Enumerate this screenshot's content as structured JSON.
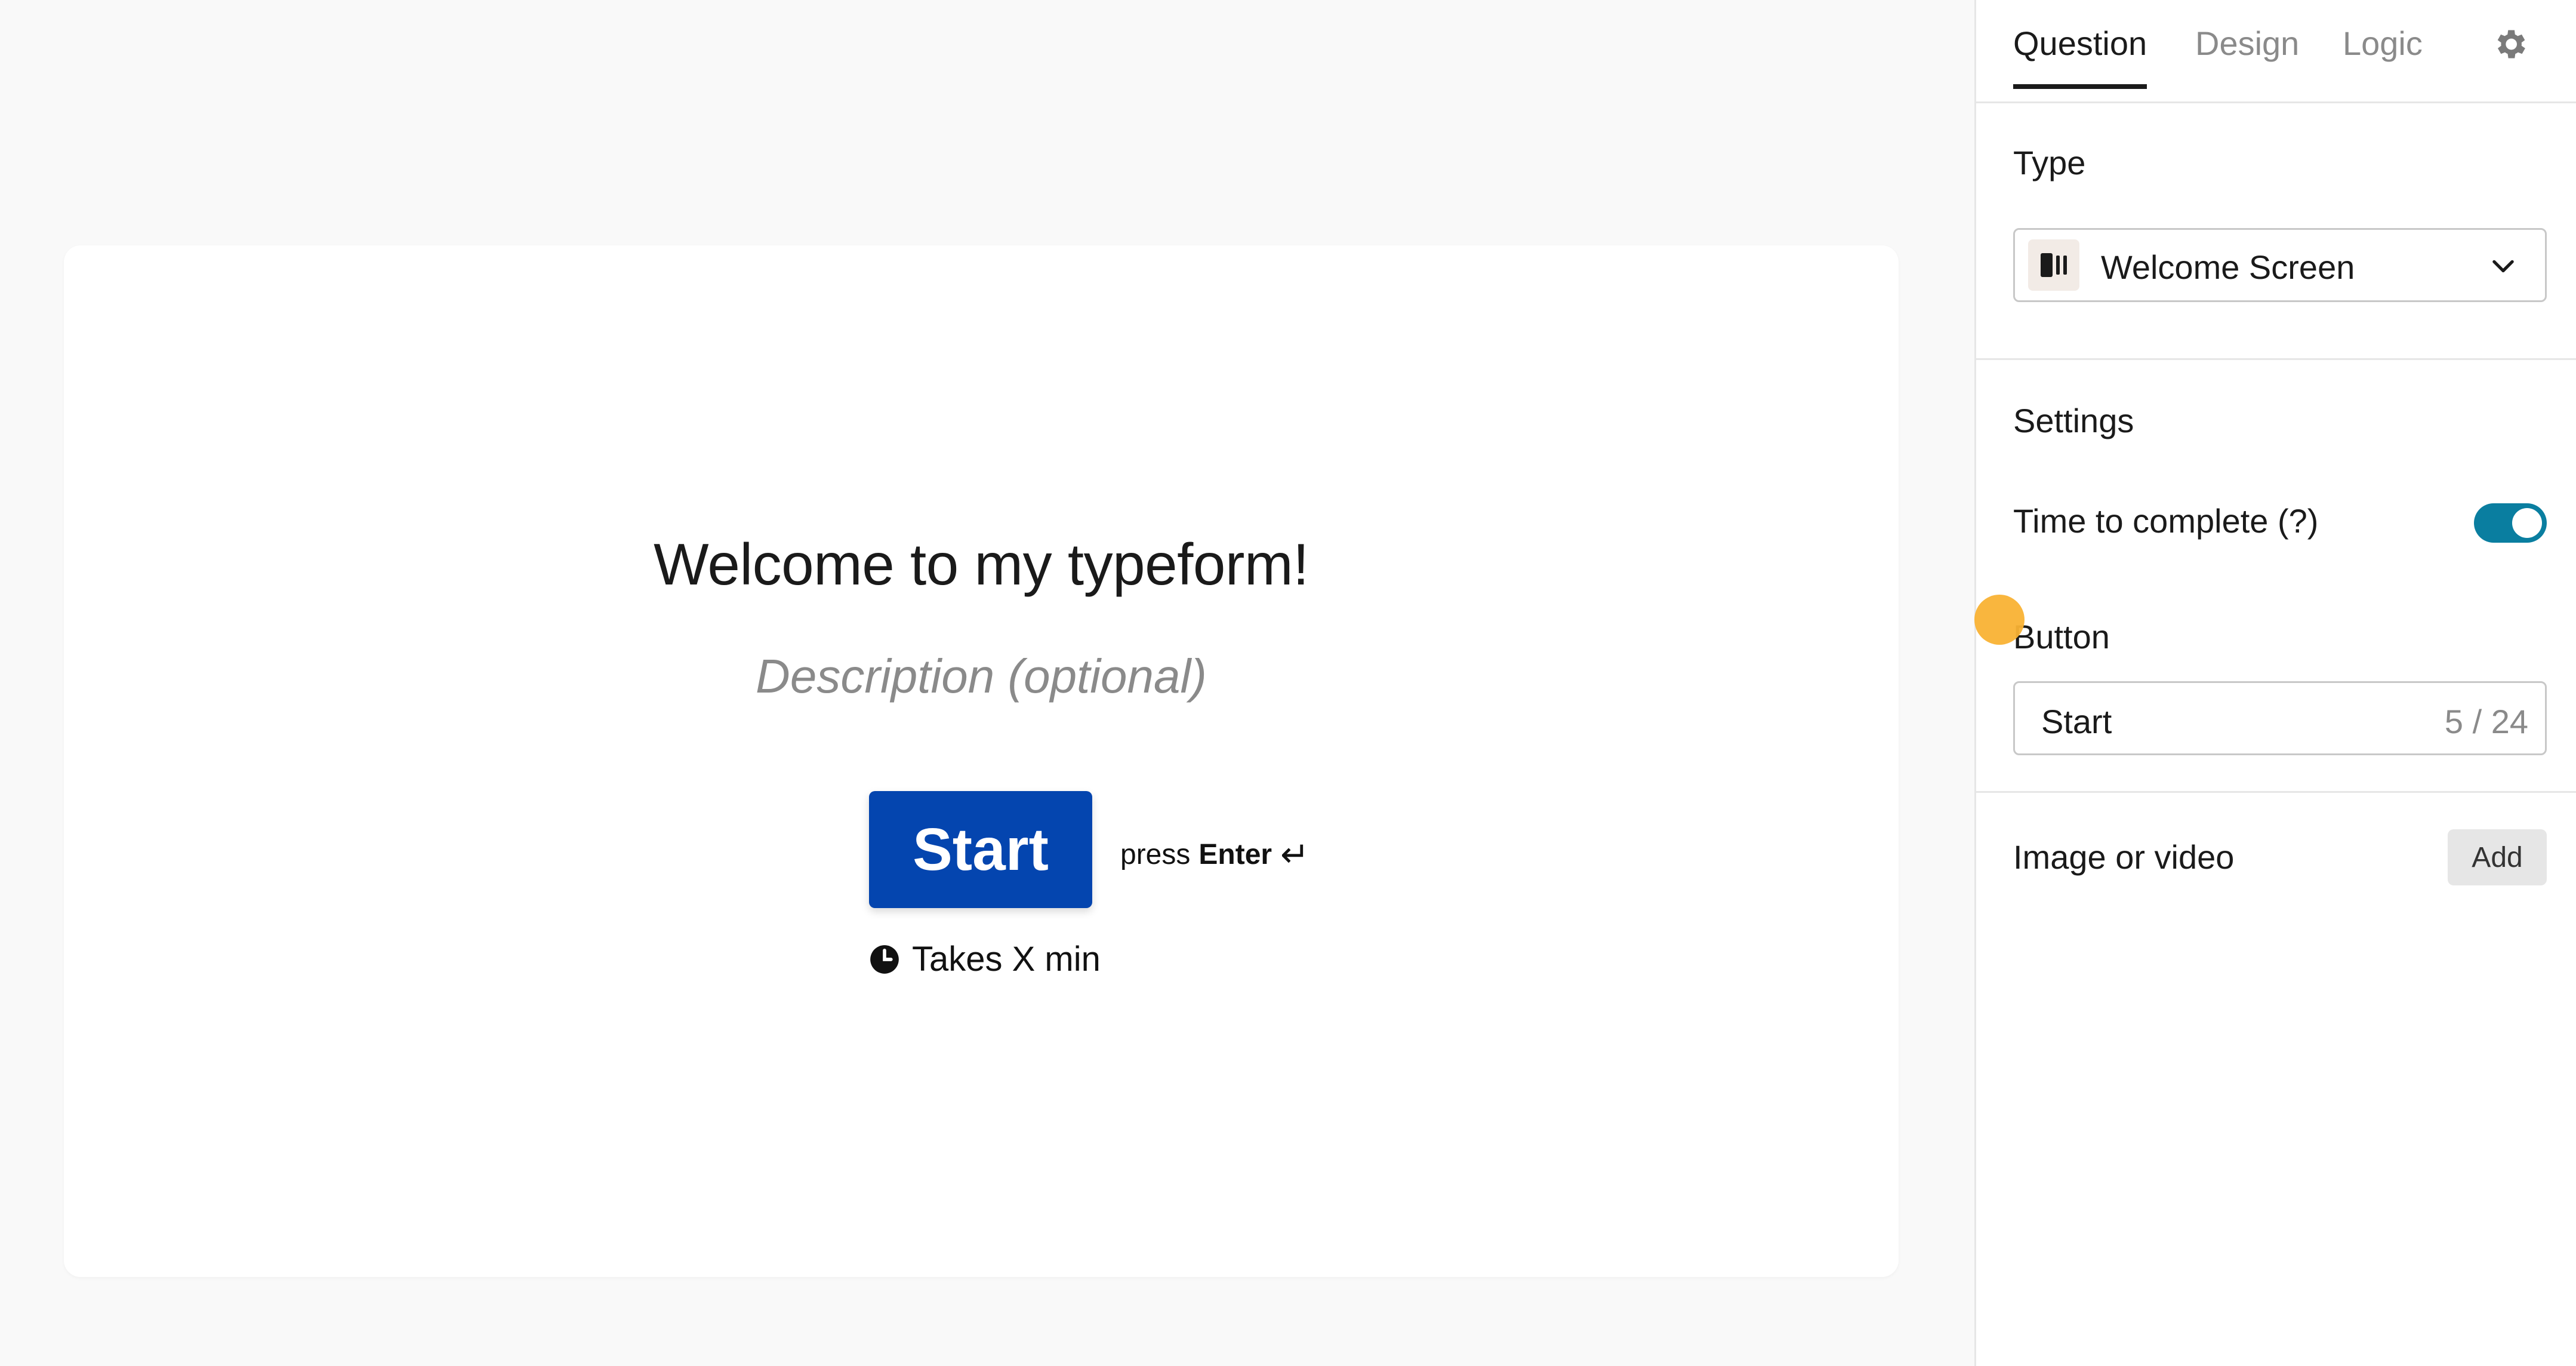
{
  "preview": {
    "title": "Welcome to my typeform!",
    "description_placeholder": "Description (optional)",
    "button_label": "Start",
    "press_label": "press",
    "enter_label": "Enter",
    "enter_icon": "↵",
    "time_label": "Takes X min",
    "button_color": "#0445af"
  },
  "panel": {
    "tabs": [
      {
        "label": "Question",
        "active": true
      },
      {
        "label": "Design",
        "active": false
      },
      {
        "label": "Logic",
        "active": false
      }
    ],
    "settings_icon": "gear-icon",
    "type": {
      "heading": "Type",
      "selected": "Welcome Screen",
      "icon": "welcome-screen-icon"
    },
    "settings": {
      "heading": "Settings",
      "time_to_complete_label": "Time to complete (?)",
      "time_to_complete_enabled": true,
      "toggle_color": "#0a7ea0"
    },
    "button": {
      "heading": "Button",
      "value": "Start",
      "counter": "5 / 24"
    },
    "media": {
      "heading": "Image or video",
      "add_label": "Add"
    }
  }
}
